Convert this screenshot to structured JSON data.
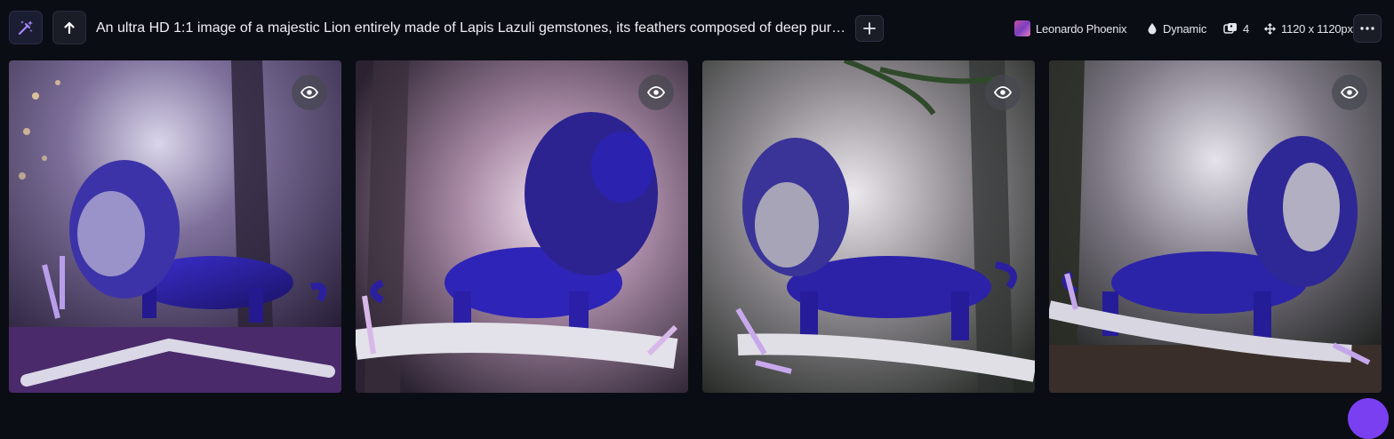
{
  "toolbar": {
    "magic_button_icon": "magic-wand-icon",
    "upload_button_icon": "arrow-up-icon",
    "prompt": "An ultra HD 1:1 image of a majestic Lion entirely made of Lapis Lazuli gemstones, its feathers composed of deep purpl...",
    "add_button_icon": "plus-icon",
    "more_button_icon": "more-horizontal-icon"
  },
  "meta": {
    "model": "Leonardo Phoenix",
    "style": "Dynamic",
    "count": "4",
    "dimensions": "1120 x 1120px"
  },
  "images": [
    {
      "name": "lion-image-1",
      "facing": "left",
      "background": "purple-forest-bokeh"
    },
    {
      "name": "lion-image-2",
      "facing": "right",
      "background": "misty-forest-glow"
    },
    {
      "name": "lion-image-3",
      "facing": "left",
      "background": "pine-forest-mist"
    },
    {
      "name": "lion-image-4",
      "facing": "right",
      "background": "dark-forest-mist"
    }
  ],
  "colors": {
    "background": "#0b0d14",
    "lapis": "#2a1f9e",
    "accent": "#7b3ff2"
  }
}
